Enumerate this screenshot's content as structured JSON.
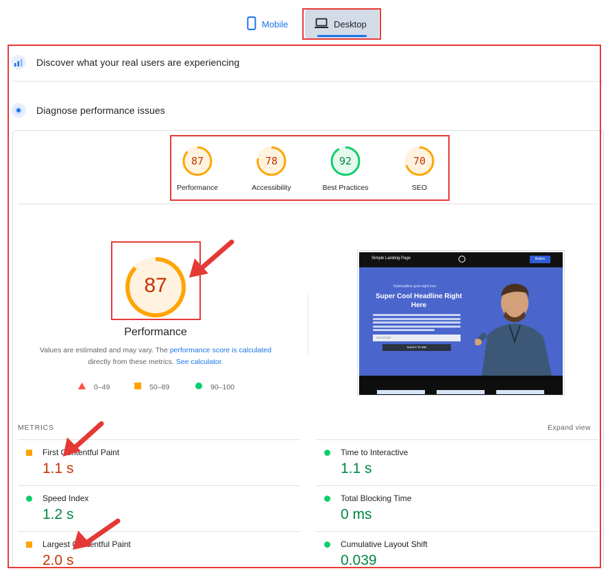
{
  "tabs": {
    "mobile": "Mobile",
    "desktop": "Desktop",
    "selected": "Desktop"
  },
  "sections": [
    {
      "label": "Discover what your real users are experiencing",
      "icon": "crux-icon"
    },
    {
      "label": "Diagnose performance issues",
      "icon": "lighthouse-icon"
    }
  ],
  "gauges": [
    {
      "score": "87",
      "label": "Performance"
    },
    {
      "score": "78",
      "label": "Accessibility"
    },
    {
      "score": "92",
      "label": "Best Practices"
    },
    {
      "score": "70",
      "label": "SEO"
    }
  ],
  "main_gauge": {
    "score": "87",
    "label": "Performance"
  },
  "note": {
    "prefix": "Values are estimated and may vary. The ",
    "link1": "performance score is calculated",
    "middle": " directly from these metrics. ",
    "link2": "See calculator."
  },
  "legend": [
    {
      "range": "0–49",
      "shape": "triangle",
      "color": "#ff4e42"
    },
    {
      "range": "50–89",
      "shape": "square",
      "color": "#ffa400"
    },
    {
      "range": "90–100",
      "shape": "circle",
      "color": "#0cce6b"
    }
  ],
  "preview": {
    "brand": "Simple Landing Page",
    "nav_button": "Button",
    "subheadline": "Subheadline goes right here",
    "headline": "Super Cool Headline Right Here",
    "email_placeholder": "Your Email",
    "cta": "Send It To Me!"
  },
  "metrics": {
    "label": "METRICS",
    "expand": "Expand view",
    "items": [
      {
        "name": "First Contentful Paint",
        "value": "1.1 s",
        "status": "average"
      },
      {
        "name": "Time to Interactive",
        "value": "1.1 s",
        "status": "pass"
      },
      {
        "name": "Speed Index",
        "value": "1.2 s",
        "status": "pass"
      },
      {
        "name": "Total Blocking Time",
        "value": "0 ms",
        "status": "pass"
      },
      {
        "name": "Largest Contentful Paint",
        "value": "2.0 s",
        "status": "average"
      },
      {
        "name": "Cumulative Layout Shift",
        "value": "0.039",
        "status": "pass"
      }
    ]
  },
  "colors": {
    "accent": "#1a73e8",
    "average": "#ffa400",
    "pass": "#0cce6b",
    "fail": "#ff4e42",
    "annotation": "#e53935"
  }
}
